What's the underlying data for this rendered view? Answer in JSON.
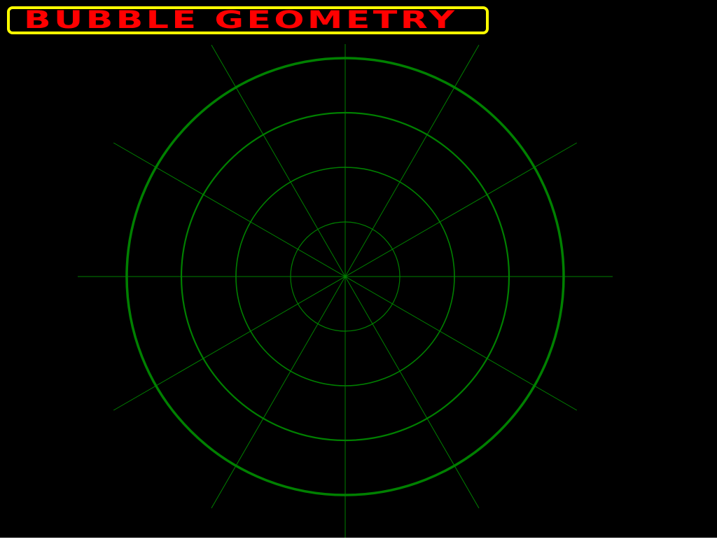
{
  "title": {
    "text": "BUBBLE GEOMETRY"
  },
  "colors": {
    "background": "#000000",
    "title_text": "#ff0000",
    "title_border": "#ffff00",
    "grid": "#008000",
    "bottom_strip": "#ffffff"
  },
  "diagram": {
    "type": "polar-grid",
    "ring_count": 4,
    "spoke_count": 12
  }
}
